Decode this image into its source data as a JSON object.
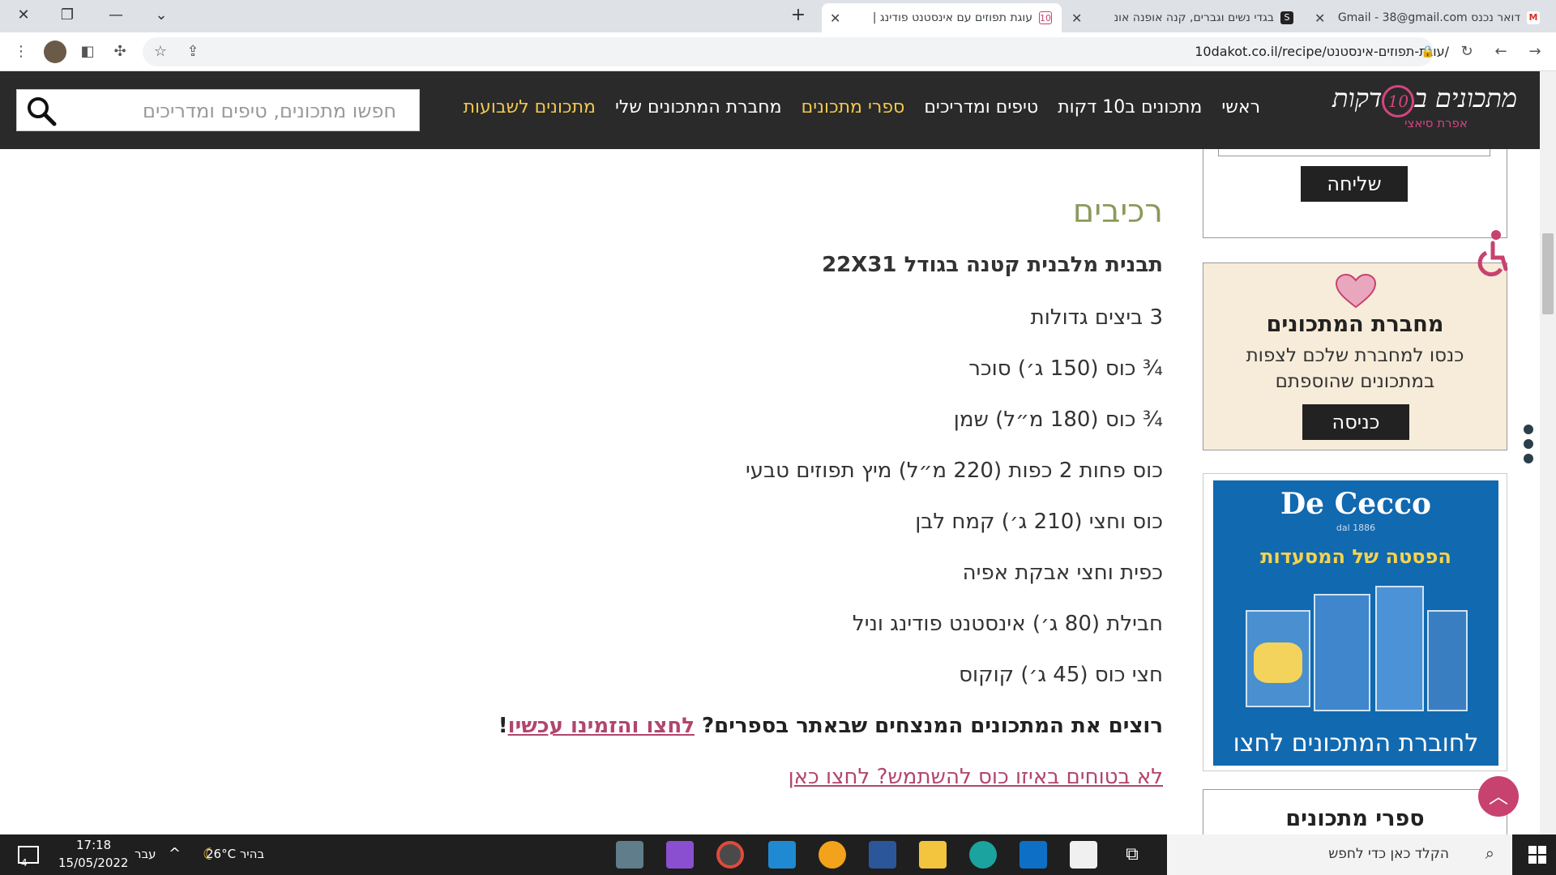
{
  "browser": {
    "tabs": [
      {
        "title": "דואר נכנס Gmail - 38@gmail.com",
        "favicon": "M"
      },
      {
        "title": "בגדי נשים וגברים, קנה אופנה אונ",
        "favicon": "S"
      },
      {
        "title": "עוגת תפוזים עם אינסטנט פודינג |",
        "favicon": "10"
      }
    ],
    "url": "10dakot.co.il/recipe/עוגת-תפוזים-אינסטנט/"
  },
  "site": {
    "logo_main": "מתכונים ב",
    "logo_num": "10",
    "logo_suffix": "דקות",
    "logo_author": "אפרת סיאצי",
    "nav": [
      "ראשי",
      "מתכונים ב10 דקות",
      "טיפים ומדריכים",
      "ספרי מתכונים",
      "מחברת המתכונים שלי",
      "מתכונים לשבועות"
    ],
    "search_placeholder": "חפשו מתכונים, טיפים ומדריכים"
  },
  "recipe": {
    "heading": "רכיבים",
    "pan": "תבנית מלבנית קטנה בגודל 22X31",
    "ingredients": [
      "3 ביצים גדולות",
      "¾ כוס (150 ג׳) סוכר",
      "¾ כוס (180 מ״ל) שמן",
      "כוס פחות 2 כפות (220 מ״ל) מיץ תפוזים טבעי",
      "כוס וחצי (210 ג׳) קמח לבן",
      "כפית וחצי אבקת אפיה",
      "חבילת (80 ג׳) אינסטנט פודינג וניל",
      "חצי כוס (45 ג׳) קוקוס"
    ],
    "promo_text": "רוצים את המתכונים המנצחים שבאתר בספרים?",
    "promo_link": "לחצו והזמינו עכשיו",
    "promo_end": "!",
    "cup_link": "לא בטוחים באיזו כוס להשתמש? לחצו כאן"
  },
  "sidebar": {
    "send_button": "שליחה",
    "notebook_title": "מחברת המתכונים",
    "notebook_desc_1": "כנסו למחברת שלכם לצפות",
    "notebook_desc_2": "במתכונים שהוספתם",
    "notebook_button": "כניסה",
    "ad_brand": "De Cecco",
    "ad_since": "dal 1886",
    "ad_tagline": "הפסטה של המסעדות",
    "ad_cta": "לחוברת המתכונים לחצו",
    "books_title": "ספרי מתכונים"
  },
  "taskbar": {
    "search_text": "הקלד כאן כדי לחפש",
    "weather": "בהיר  26°C",
    "lang": "עבר",
    "time": "17:18",
    "date": "15/05/2022",
    "notif_count": "4"
  },
  "colors": {
    "accent_pink": "#c8426f",
    "heading_olive": "#8a9a5b",
    "nav_gold": "#f2c94c",
    "header_bg": "#2a2a2a"
  }
}
